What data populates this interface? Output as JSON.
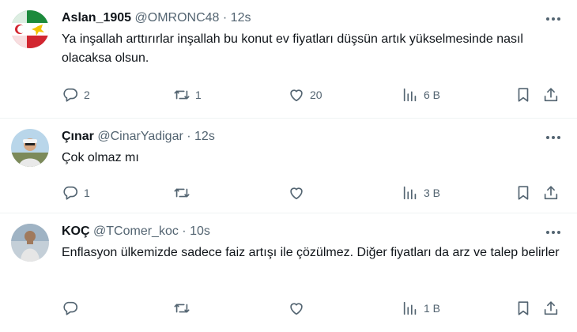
{
  "tweets": [
    {
      "name": "Aslan_1905",
      "handle": "@OMRONC48",
      "separator": "·",
      "time": "12s",
      "text": "Ya inşallah arttırırlar inşallah bu konut ev fiyatları düşsün artık yükselmesinde nasıl olacaksa olsun.",
      "replies": "2",
      "retweets": "1",
      "likes": "20",
      "views": "6 B"
    },
    {
      "name": "Çınar",
      "handle": "@CinarYadigar",
      "separator": "·",
      "time": "12s",
      "text": "Çok olmaz mı",
      "replies": "1",
      "retweets": "",
      "likes": "",
      "views": "3 B"
    },
    {
      "name": "KOÇ",
      "handle": "@TComer_koc",
      "separator": "·",
      "time": "10s",
      "text": "Enflasyon ülkemizde sadece faiz artışı ile çözülmez. Diğer fiyatları da arz ve talep belirler",
      "replies": "",
      "retweets": "",
      "likes": "",
      "views": "1 B"
    }
  ],
  "colors": {
    "text": "#0f1419",
    "secondary": "#536471",
    "divider": "#eff3f4"
  },
  "icons": [
    "reply-icon",
    "retweet-icon",
    "like-icon",
    "views-icon",
    "bookmark-icon",
    "share-icon",
    "more-icon"
  ]
}
